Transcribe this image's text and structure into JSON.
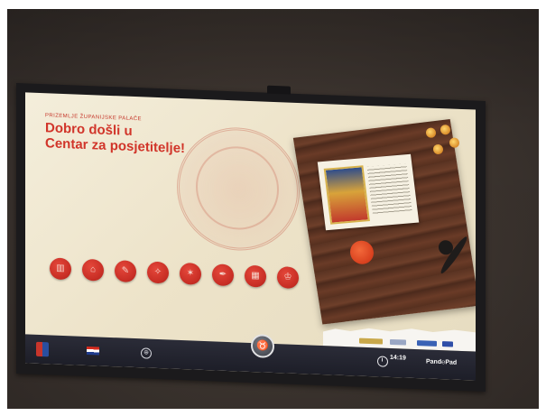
{
  "kiosk": {
    "kicker": "Prizemlje županijske palače",
    "headline_line1": "Dobro došli u",
    "headline_line2": "Centar za posjetitelje!",
    "intro_blurb": ""
  },
  "seal_buttons": [
    {
      "icon": "castle-icon",
      "glyph": "▥"
    },
    {
      "icon": "building-icon",
      "glyph": "⌂"
    },
    {
      "icon": "quill-icon",
      "glyph": "✎"
    },
    {
      "icon": "compass-icon",
      "glyph": "✧"
    },
    {
      "icon": "crest-icon",
      "glyph": "✶"
    },
    {
      "icon": "pen-icon",
      "glyph": "✒"
    },
    {
      "icon": "gallery-icon",
      "glyph": "▦"
    },
    {
      "icon": "crown-icon",
      "glyph": "♔"
    }
  ],
  "bottom_bar": {
    "home_glyph": "♉",
    "time": "14:19",
    "brand": "Pand℮Pad"
  },
  "colors": {
    "accent_red": "#d1352a",
    "bar": "#1d1e28",
    "screen_bg": "#f4eedb"
  }
}
